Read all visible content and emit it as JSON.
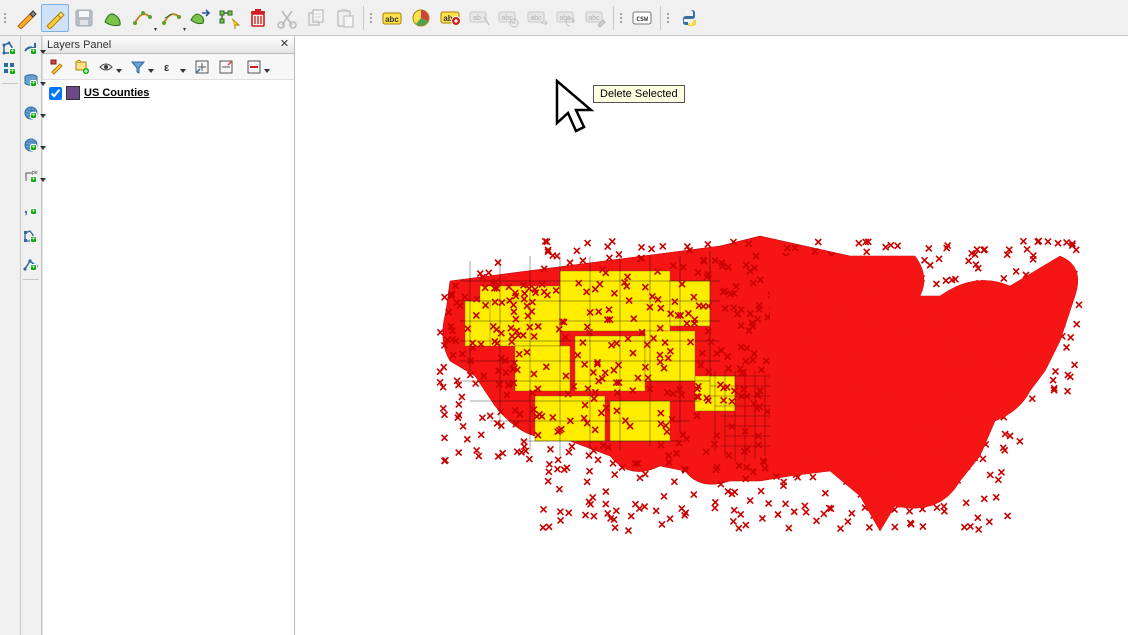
{
  "layers_panel": {
    "title": "Layers Panel",
    "layer_name": "US Counties"
  },
  "tooltip": {
    "text": "Delete Selected"
  },
  "toolbars": {
    "top_buttons": [
      "current-edits",
      "toggle-editing",
      "save-layer-edits",
      "add-feature",
      "add-circular-string",
      "add-circular-string-radius",
      "move-feature",
      "node-tool",
      "delete-selected",
      "cut-features",
      "copy-features",
      "paste-features"
    ],
    "label_buttons": [
      "layer-labeling-options",
      "layer-diagrams",
      "highlight-pinned",
      "pin-unpin-labels",
      "show-hide-labels",
      "move-label",
      "rotate-label",
      "change-label"
    ],
    "misc_buttons": [
      "csw",
      "python-console"
    ]
  },
  "left_toolbar_a": [
    "new-shapefile-layer",
    "new-spatialite-layer"
  ],
  "left_toolbar_b": [
    "new-geopackage",
    "wfs-layer",
    "wms-layer",
    "wcs-layer",
    "virtual-layer",
    "delimited-text",
    "gpx-layer",
    "vector-layer"
  ],
  "layers_toolbar_buttons": [
    "open-style-dock",
    "add-group",
    "visibility-toggle",
    "filter-legend",
    "expression-filter",
    "expand-all",
    "collapse-all",
    "remove-layer"
  ]
}
